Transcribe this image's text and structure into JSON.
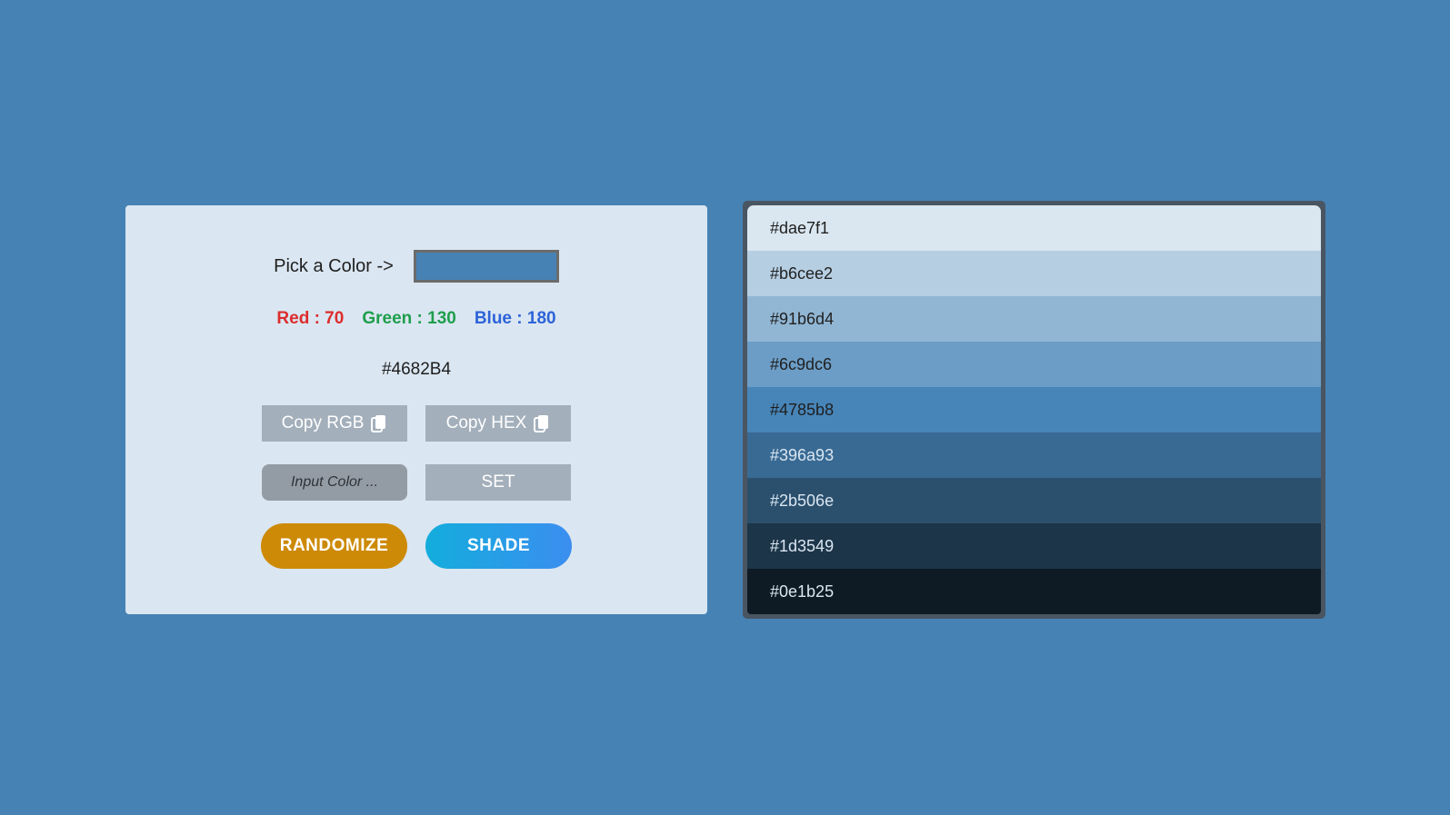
{
  "picker": {
    "label": "Pick a Color ->",
    "value": "#4682B4"
  },
  "rgb": {
    "red_label": "Red : 70",
    "green_label": "Green : 130",
    "blue_label": "Blue : 180"
  },
  "hex_display": "#4682B4",
  "buttons": {
    "copy_rgb": "Copy RGB",
    "copy_hex": "Copy HEX",
    "set": "SET",
    "randomize": "RANDOMIZE",
    "shade": "SHADE"
  },
  "input": {
    "placeholder": "Input Color ..."
  },
  "icons": {
    "copy": "copy-icon"
  },
  "colors": {
    "background": "#4682B4",
    "card": "#dae6f1",
    "red": "#dc2d2d",
    "green": "#1e9e4c",
    "blue": "#2d63d9",
    "randomize": "#cd8a06",
    "shade_gradient_start": "#13addc",
    "shade_gradient_end": "#3b8ef0"
  },
  "shades": [
    {
      "hex": "#dae7f1",
      "text_color": "#1f1f1f"
    },
    {
      "hex": "#b6cee2",
      "text_color": "#1f1f1f"
    },
    {
      "hex": "#91b6d4",
      "text_color": "#1f1f1f"
    },
    {
      "hex": "#6c9dc6",
      "text_color": "#1f1f1f"
    },
    {
      "hex": "#4785b8",
      "text_color": "#1f1f1f"
    },
    {
      "hex": "#396a93",
      "text_color": "#dae6f1"
    },
    {
      "hex": "#2b506e",
      "text_color": "#dae6f1"
    },
    {
      "hex": "#1d3549",
      "text_color": "#dae6f1"
    },
    {
      "hex": "#0e1b25",
      "text_color": "#dae6f1"
    }
  ]
}
